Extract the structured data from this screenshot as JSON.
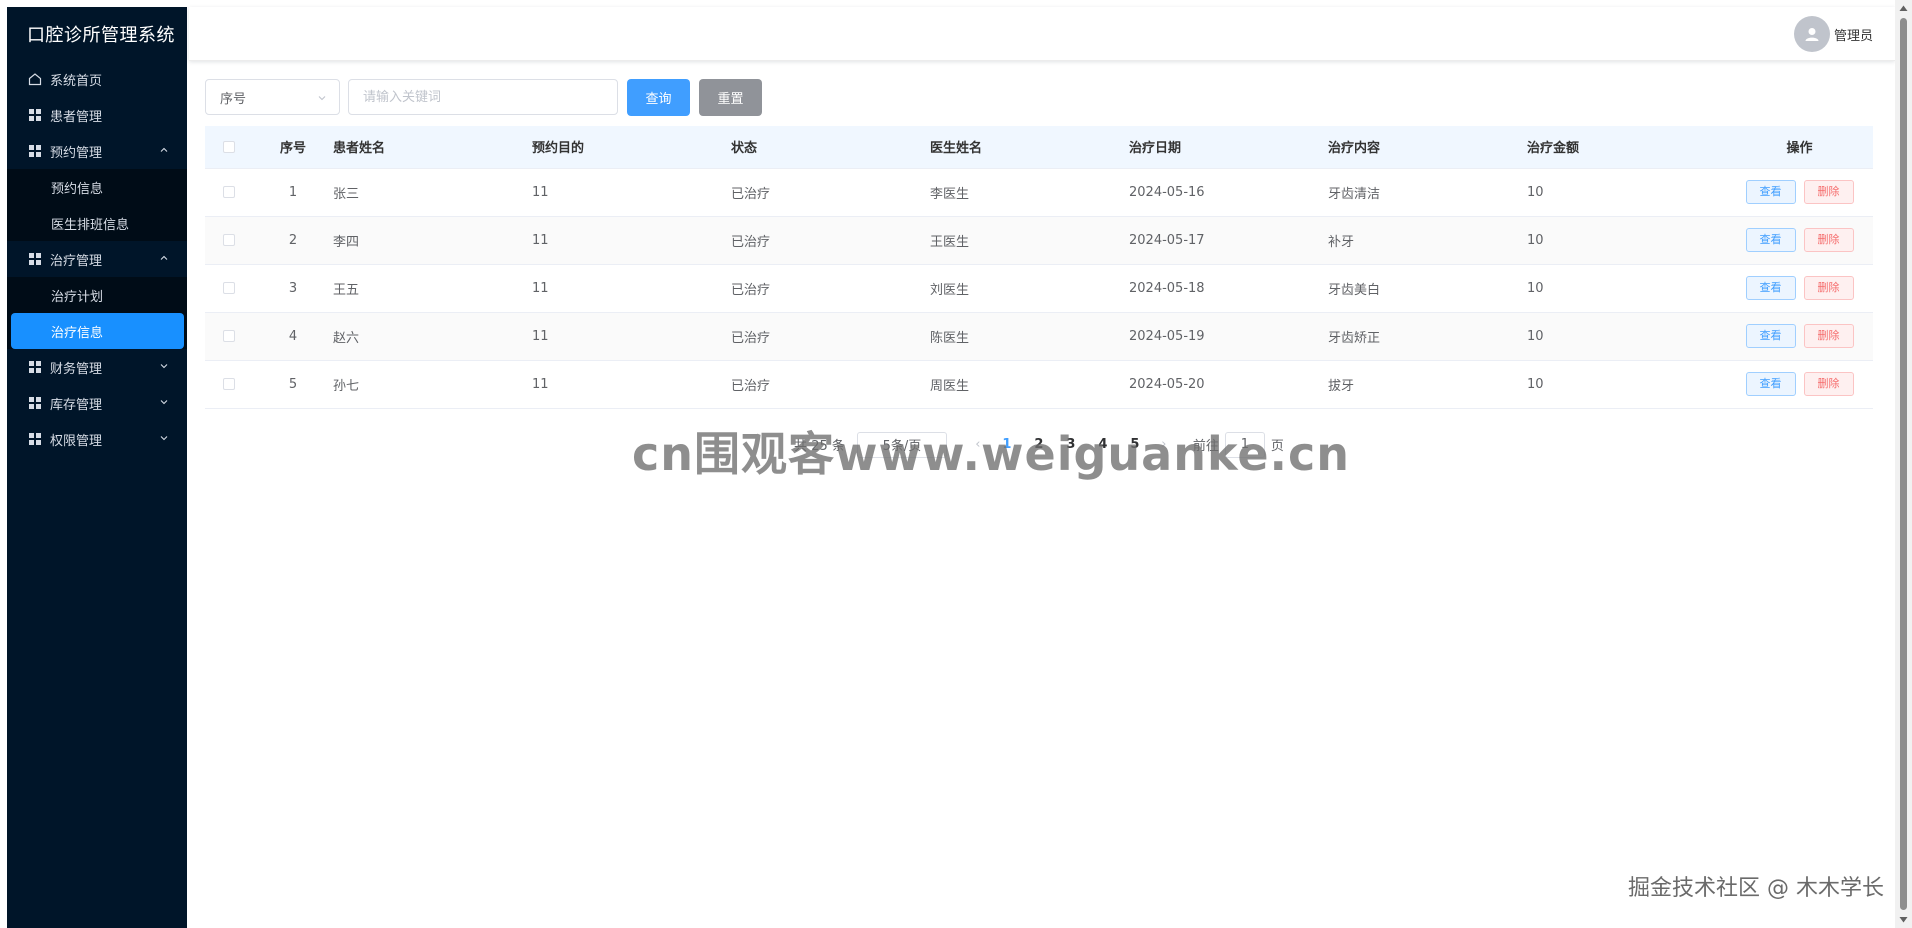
{
  "app": {
    "title": "口腔诊所管理系统"
  },
  "sidebar": {
    "home": "系统首页",
    "patients": "患者管理",
    "appointments": {
      "label": "预约管理",
      "children": [
        "预约信息",
        "医生排班信息"
      ]
    },
    "treatment": {
      "label": "治疗管理",
      "children": [
        "治疗计划",
        "治疗信息"
      ]
    },
    "finance": "财务管理",
    "inventory": "库存管理",
    "permissions": "权限管理"
  },
  "header": {
    "user": "管理员"
  },
  "search": {
    "field": "序号",
    "placeholder": "请输入关键词",
    "query_label": "查询",
    "reset_label": "重置"
  },
  "table": {
    "columns": [
      "序号",
      "患者姓名",
      "预约目的",
      "状态",
      "医生姓名",
      "治疗日期",
      "治疗内容",
      "治疗金额",
      "操作"
    ],
    "rows": [
      {
        "no": "1",
        "patient": "张三",
        "purpose": "11",
        "status": "已治疗",
        "doctor": "李医生",
        "date": "2024-05-16",
        "content": "牙齿清洁",
        "amount": "10"
      },
      {
        "no": "2",
        "patient": "李四",
        "purpose": "11",
        "status": "已治疗",
        "doctor": "王医生",
        "date": "2024-05-17",
        "content": "补牙",
        "amount": "10"
      },
      {
        "no": "3",
        "patient": "王五",
        "purpose": "11",
        "status": "已治疗",
        "doctor": "刘医生",
        "date": "2024-05-18",
        "content": "牙齿美白",
        "amount": "10"
      },
      {
        "no": "4",
        "patient": "赵六",
        "purpose": "11",
        "status": "已治疗",
        "doctor": "陈医生",
        "date": "2024-05-19",
        "content": "牙齿矫正",
        "amount": "10"
      },
      {
        "no": "5",
        "patient": "孙七",
        "purpose": "11",
        "status": "已治疗",
        "doctor": "周医生",
        "date": "2024-05-20",
        "content": "拔牙",
        "amount": "10"
      }
    ],
    "view_label": "查看",
    "delete_label": "删除"
  },
  "pagination": {
    "total": "共 25 条",
    "page_size": "5条/页",
    "prev": "‹",
    "next": "›",
    "pages": [
      "1",
      "2",
      "3",
      "4",
      "5"
    ],
    "current": "1",
    "goto_label": "前往",
    "goto_value": "1",
    "page_suffix": "页"
  },
  "watermarks": {
    "center": "cn围观客www.weiguanke.cn",
    "corner": "掘金技术社区 @ 木木学长"
  },
  "colors": {
    "sidebar_bg": "#001529",
    "submenu_bg": "#000c17",
    "active": "#1890ff",
    "primary": "#409eff",
    "info": "#909399",
    "danger": "#f56c6c"
  }
}
